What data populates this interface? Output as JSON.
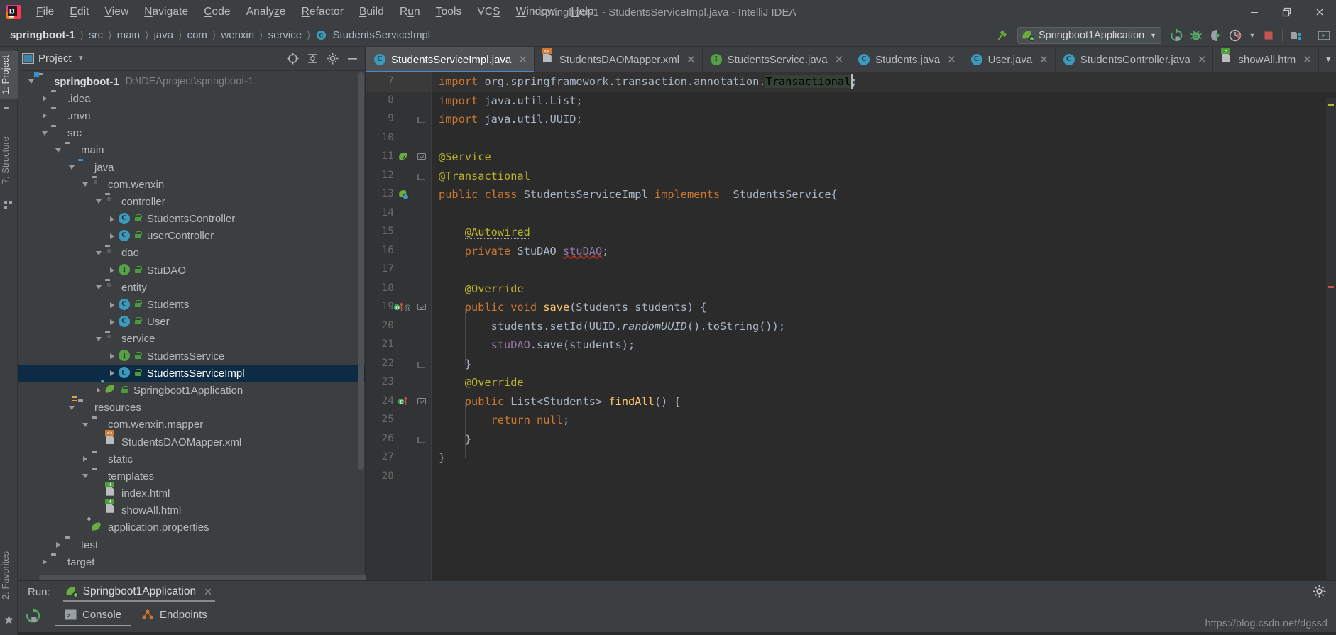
{
  "window": {
    "title": "springboot-1 - StudentsServiceImpl.java - IntelliJ IDEA",
    "minimize": "—",
    "restore": "❐",
    "close": "✕",
    "logo_name": "intellij-idea-logo"
  },
  "menu": [
    {
      "label": "File",
      "mnemonic": "F"
    },
    {
      "label": "Edit",
      "mnemonic": "E"
    },
    {
      "label": "View",
      "mnemonic": "V"
    },
    {
      "label": "Navigate",
      "mnemonic": "N"
    },
    {
      "label": "Code",
      "mnemonic": "C"
    },
    {
      "label": "Analyze",
      "mnemonic": "z"
    },
    {
      "label": "Refactor",
      "mnemonic": "R"
    },
    {
      "label": "Build",
      "mnemonic": "B"
    },
    {
      "label": "Run",
      "mnemonic": "u"
    },
    {
      "label": "Tools",
      "mnemonic": "T"
    },
    {
      "label": "VCS",
      "mnemonic": "S"
    },
    {
      "label": "Window",
      "mnemonic": "W"
    },
    {
      "label": "Help",
      "mnemonic": "H"
    }
  ],
  "breadcrumb": [
    {
      "label": "springboot-1",
      "icon": "project-icon"
    },
    {
      "label": "src",
      "icon": "folder-icon"
    },
    {
      "label": "main",
      "icon": "folder-icon"
    },
    {
      "label": "java",
      "icon": "folder-icon"
    },
    {
      "label": "com",
      "icon": "package-icon"
    },
    {
      "label": "wenxin",
      "icon": "package-icon"
    },
    {
      "label": "service",
      "icon": "package-icon"
    },
    {
      "label": "StudentsServiceImpl",
      "icon": "class-icon"
    }
  ],
  "toolbar": {
    "run_config_name": "Springboot1Application",
    "run_config_icon": "spring-boot-icon",
    "dropdown_icon": "chevron-down-icon",
    "hammer_icon": "build-hammer-icon",
    "buttons": [
      {
        "name": "run-button",
        "icon": "run-icon"
      },
      {
        "name": "debug-button",
        "icon": "debug-bug-icon"
      },
      {
        "name": "run-coverage-button",
        "icon": "coverage-icon"
      },
      {
        "name": "profiler-button",
        "icon": "profiler-icon"
      },
      {
        "name": "profiler-dropdown",
        "icon": "chevron-down-icon"
      },
      {
        "name": "stop-button",
        "icon": "stop-square-icon"
      },
      {
        "name": "project-structure-button",
        "icon": "project-structure-icon"
      },
      {
        "name": "search-everywhere-button",
        "icon": "terminal-window-icon"
      }
    ]
  },
  "left_stripe": [
    {
      "label": "1: Project",
      "mnemonic": "1",
      "active": true,
      "icon": "project-tool-icon"
    },
    {
      "label": "7: Structure",
      "mnemonic": "7",
      "active": false,
      "icon": "structure-tool-icon"
    },
    {
      "label": "2: Favorites",
      "mnemonic": "2",
      "active": false,
      "icon": "favorites-star-icon"
    }
  ],
  "project_panel": {
    "title": "Project",
    "view_selector_icon": "chevron-down-icon",
    "header_icons": [
      {
        "name": "scroll-from-source-button",
        "icon": "target-crosshair-icon"
      },
      {
        "name": "collapse-all-button",
        "icon": "collapse-all-icon"
      },
      {
        "name": "settings-button",
        "icon": "gear-icon"
      },
      {
        "name": "hide-button",
        "icon": "minimize-line-icon"
      }
    ],
    "tree": [
      {
        "label": "springboot-1",
        "detail": "D:\\IDEAproject\\springboot-1",
        "depth": 0,
        "twist": "open",
        "icon": "project-module-icon",
        "bold": true,
        "vis": ""
      },
      {
        "label": ".idea",
        "detail": "",
        "depth": 1,
        "twist": "closed",
        "icon": "folder-icon",
        "bold": false,
        "vis": ""
      },
      {
        "label": ".mvn",
        "detail": "",
        "depth": 1,
        "twist": "closed",
        "icon": "folder-icon",
        "bold": false,
        "vis": ""
      },
      {
        "label": "src",
        "detail": "",
        "depth": 1,
        "twist": "open",
        "icon": "folder-icon",
        "bold": false,
        "vis": ""
      },
      {
        "label": "main",
        "detail": "",
        "depth": 2,
        "twist": "open",
        "icon": "folder-icon",
        "bold": false,
        "vis": ""
      },
      {
        "label": "java",
        "detail": "",
        "depth": 3,
        "twist": "open",
        "icon": "source-folder-icon",
        "bold": false,
        "vis": ""
      },
      {
        "label": "com.wenxin",
        "detail": "",
        "depth": 4,
        "twist": "open",
        "icon": "package-icon",
        "bold": false,
        "vis": ""
      },
      {
        "label": "controller",
        "detail": "",
        "depth": 5,
        "twist": "open",
        "icon": "package-icon",
        "bold": false,
        "vis": ""
      },
      {
        "label": "StudentsController",
        "detail": "",
        "depth": 6,
        "twist": "closed",
        "icon": "java-class-icon",
        "bold": false,
        "vis": "public-lock-icon"
      },
      {
        "label": "userController",
        "detail": "",
        "depth": 6,
        "twist": "closed",
        "icon": "java-class-icon",
        "bold": false,
        "vis": "public-lock-icon"
      },
      {
        "label": "dao",
        "detail": "",
        "depth": 5,
        "twist": "open",
        "icon": "package-icon",
        "bold": false,
        "vis": ""
      },
      {
        "label": "StuDAO",
        "detail": "",
        "depth": 6,
        "twist": "closed",
        "icon": "java-interface-icon",
        "bold": false,
        "vis": "public-lock-icon"
      },
      {
        "label": "entity",
        "detail": "",
        "depth": 5,
        "twist": "open",
        "icon": "package-icon",
        "bold": false,
        "vis": ""
      },
      {
        "label": "Students",
        "detail": "",
        "depth": 6,
        "twist": "closed",
        "icon": "java-class-icon",
        "bold": false,
        "vis": "public-lock-icon"
      },
      {
        "label": "User",
        "detail": "",
        "depth": 6,
        "twist": "closed",
        "icon": "java-class-icon",
        "bold": false,
        "vis": "public-lock-icon"
      },
      {
        "label": "service",
        "detail": "",
        "depth": 5,
        "twist": "open",
        "icon": "package-icon",
        "bold": false,
        "vis": ""
      },
      {
        "label": "StudentsService",
        "detail": "",
        "depth": 6,
        "twist": "closed",
        "icon": "java-interface-icon",
        "bold": false,
        "vis": "public-lock-icon"
      },
      {
        "label": "StudentsServiceImpl",
        "detail": "",
        "depth": 6,
        "twist": "closed",
        "icon": "java-class-icon",
        "bold": false,
        "vis": "public-lock-icon",
        "selected": true
      },
      {
        "label": "Springboot1Application",
        "detail": "",
        "depth": 5,
        "twist": "closed",
        "icon": "spring-boot-class-icon",
        "bold": false,
        "vis": "public-lock-icon"
      },
      {
        "label": "resources",
        "detail": "",
        "depth": 3,
        "twist": "open",
        "icon": "resources-folder-icon",
        "bold": false,
        "vis": ""
      },
      {
        "label": "com.wenxin.mapper",
        "detail": "",
        "depth": 4,
        "twist": "open",
        "icon": "folder-icon",
        "bold": false,
        "vis": ""
      },
      {
        "label": "StudentsDAOMapper.xml",
        "detail": "",
        "depth": 5,
        "twist": "none",
        "icon": "xml-file-icon",
        "bold": false,
        "vis": ""
      },
      {
        "label": "static",
        "detail": "",
        "depth": 4,
        "twist": "closed",
        "icon": "folder-icon",
        "bold": false,
        "vis": ""
      },
      {
        "label": "templates",
        "detail": "",
        "depth": 4,
        "twist": "open",
        "icon": "folder-icon",
        "bold": false,
        "vis": ""
      },
      {
        "label": "index.html",
        "detail": "",
        "depth": 5,
        "twist": "none",
        "icon": "html-file-icon",
        "bold": false,
        "vis": ""
      },
      {
        "label": "showAll.html",
        "detail": "",
        "depth": 5,
        "twist": "none",
        "icon": "html-file-icon",
        "bold": false,
        "vis": ""
      },
      {
        "label": "application.properties",
        "detail": "",
        "depth": 4,
        "twist": "none",
        "icon": "spring-properties-icon",
        "bold": false,
        "vis": ""
      },
      {
        "label": "test",
        "detail": "",
        "depth": 2,
        "twist": "closed",
        "icon": "folder-icon",
        "bold": false,
        "vis": ""
      },
      {
        "label": "target",
        "detail": "",
        "depth": 1,
        "twist": "closed",
        "icon": "target-folder-icon",
        "bold": false,
        "vis": ""
      }
    ]
  },
  "editor_tabs": [
    {
      "label": "StudentsServiceImpl.java",
      "icon": "java-class-icon",
      "active": true
    },
    {
      "label": "StudentsDAOMapper.xml",
      "icon": "xml-file-icon",
      "active": false
    },
    {
      "label": "StudentsService.java",
      "icon": "java-interface-icon",
      "active": false
    },
    {
      "label": "Students.java",
      "icon": "java-class-icon",
      "active": false
    },
    {
      "label": "User.java",
      "icon": "java-class-icon",
      "active": false
    },
    {
      "label": "StudentsController.java",
      "icon": "java-class-icon",
      "active": false
    },
    {
      "label": "showAll.htm",
      "icon": "html-file-icon",
      "active": false
    }
  ],
  "editor_tabs_overflow_icon": "chevron-down-icon",
  "code": {
    "first_line_number": 7,
    "last_line_number": 28,
    "caret_line": 7,
    "lines": [
      {
        "n": 7,
        "indent": 0,
        "tokens": [
          {
            "t": "import",
            "c": "kw"
          },
          {
            "t": " org.springframework.transaction.annotation.",
            "c": "pln"
          },
          {
            "t": "Transactional",
            "c": "hl-ref"
          },
          {
            "t": ";",
            "c": "pln"
          }
        ],
        "fold": "none",
        "mark": ""
      },
      {
        "n": 8,
        "indent": 0,
        "tokens": [
          {
            "t": "import",
            "c": "kw"
          },
          {
            "t": " java.util.List;",
            "c": "pln"
          }
        ],
        "fold": "none",
        "mark": ""
      },
      {
        "n": 9,
        "indent": 0,
        "tokens": [
          {
            "t": "import",
            "c": "kw"
          },
          {
            "t": " java.util.UUID;",
            "c": "pln"
          }
        ],
        "fold": "end",
        "mark": ""
      },
      {
        "n": 10,
        "indent": 0,
        "tokens": [],
        "fold": "none",
        "mark": ""
      },
      {
        "n": 11,
        "indent": 0,
        "tokens": [
          {
            "t": "@Service",
            "c": "ann"
          }
        ],
        "fold": "start",
        "mark": "spring-bean-icon"
      },
      {
        "n": 12,
        "indent": 0,
        "tokens": [
          {
            "t": "@Transactional",
            "c": "ann"
          }
        ],
        "fold": "end",
        "mark": ""
      },
      {
        "n": 13,
        "indent": 0,
        "tokens": [
          {
            "t": "public class ",
            "c": "kw"
          },
          {
            "t": "StudentsServiceImpl ",
            "c": "cls"
          },
          {
            "t": "implements",
            "c": "kw"
          },
          {
            "t": "  StudentsService{",
            "c": "cls"
          }
        ],
        "fold": "none",
        "mark": "spring-bean-impl-icon"
      },
      {
        "n": 14,
        "indent": 0,
        "tokens": [],
        "fold": "none",
        "mark": ""
      },
      {
        "n": 15,
        "indent": 1,
        "tokens": [
          {
            "t": "@Autowired",
            "c": "ann-warn"
          }
        ],
        "fold": "none",
        "mark": ""
      },
      {
        "n": 16,
        "indent": 1,
        "tokens": [
          {
            "t": "private ",
            "c": "kw"
          },
          {
            "t": "StuDAO ",
            "c": "cls"
          },
          {
            "t": "stuDAO",
            "c": "fld-err"
          },
          {
            "t": ";",
            "c": "pln"
          }
        ],
        "fold": "none",
        "mark": ""
      },
      {
        "n": 17,
        "indent": 1,
        "tokens": [],
        "fold": "none",
        "mark": ""
      },
      {
        "n": 18,
        "indent": 1,
        "tokens": [
          {
            "t": "@Override",
            "c": "ann"
          }
        ],
        "fold": "none",
        "mark": ""
      },
      {
        "n": 19,
        "indent": 1,
        "tokens": [
          {
            "t": "public void ",
            "c": "kw"
          },
          {
            "t": "save",
            "c": "mth"
          },
          {
            "t": "(Students students) {",
            "c": "pln"
          }
        ],
        "fold": "start",
        "mark": "override-impl-icon"
      },
      {
        "n": 20,
        "indent": 2,
        "tokens": [
          {
            "t": "students.setId(UUID.",
            "c": "pln"
          },
          {
            "t": "randomUUID",
            "c": "stat"
          },
          {
            "t": "().toString());",
            "c": "pln"
          }
        ],
        "fold": "none",
        "mark": ""
      },
      {
        "n": 21,
        "indent": 2,
        "tokens": [
          {
            "t": "stuDAO",
            "c": "fld"
          },
          {
            "t": ".save(students);",
            "c": "pln"
          }
        ],
        "fold": "none",
        "mark": ""
      },
      {
        "n": 22,
        "indent": 1,
        "tokens": [
          {
            "t": "}",
            "c": "pln"
          }
        ],
        "fold": "end",
        "mark": ""
      },
      {
        "n": 23,
        "indent": 1,
        "tokens": [
          {
            "t": "@Override",
            "c": "ann"
          }
        ],
        "fold": "none",
        "mark": ""
      },
      {
        "n": 24,
        "indent": 1,
        "tokens": [
          {
            "t": "public ",
            "c": "kw"
          },
          {
            "t": "List<Students> ",
            "c": "pln"
          },
          {
            "t": "findAll",
            "c": "mth"
          },
          {
            "t": "() {",
            "c": "pln"
          }
        ],
        "fold": "start",
        "mark": "override-icon"
      },
      {
        "n": 25,
        "indent": 2,
        "tokens": [
          {
            "t": "return null",
            "c": "kw"
          },
          {
            "t": ";",
            "c": "pln"
          }
        ],
        "fold": "none",
        "mark": ""
      },
      {
        "n": 26,
        "indent": 1,
        "tokens": [
          {
            "t": "}",
            "c": "pln"
          }
        ],
        "fold": "end",
        "mark": ""
      },
      {
        "n": 27,
        "indent": 0,
        "tokens": [
          {
            "t": "}",
            "c": "pln"
          }
        ],
        "fold": "none",
        "mark": ""
      },
      {
        "n": 28,
        "indent": 0,
        "tokens": [],
        "fold": "none",
        "mark": ""
      }
    ]
  },
  "run_panel": {
    "label": "Run:",
    "config_tab": "Springboot1Application",
    "config_tab_icon": "spring-boot-icon",
    "close_icon": "✕",
    "settings_icon": "gear-icon",
    "rerun_icon": "rerun-icon",
    "sub_tabs": [
      {
        "label": "Console",
        "icon": "console-icon",
        "active": true
      },
      {
        "label": "Endpoints",
        "icon": "endpoints-icon",
        "active": false
      }
    ]
  },
  "watermark": "https://blog.csdn.net/dgssd",
  "colors": {
    "panel_bg": "#3c3f41",
    "editor_bg": "#2b2b2b",
    "gutter_bg": "#313335",
    "selection_blue": "#0d2b45",
    "accent_blue": "#4a88c7",
    "keyword_orange": "#cc7832",
    "annotation_yellow": "#bbb529",
    "field_purple": "#9876aa",
    "method_yellow": "#ffc66d",
    "text_gray": "#a9b7c6",
    "stop_red": "#c75450",
    "run_green": "#59a869"
  }
}
